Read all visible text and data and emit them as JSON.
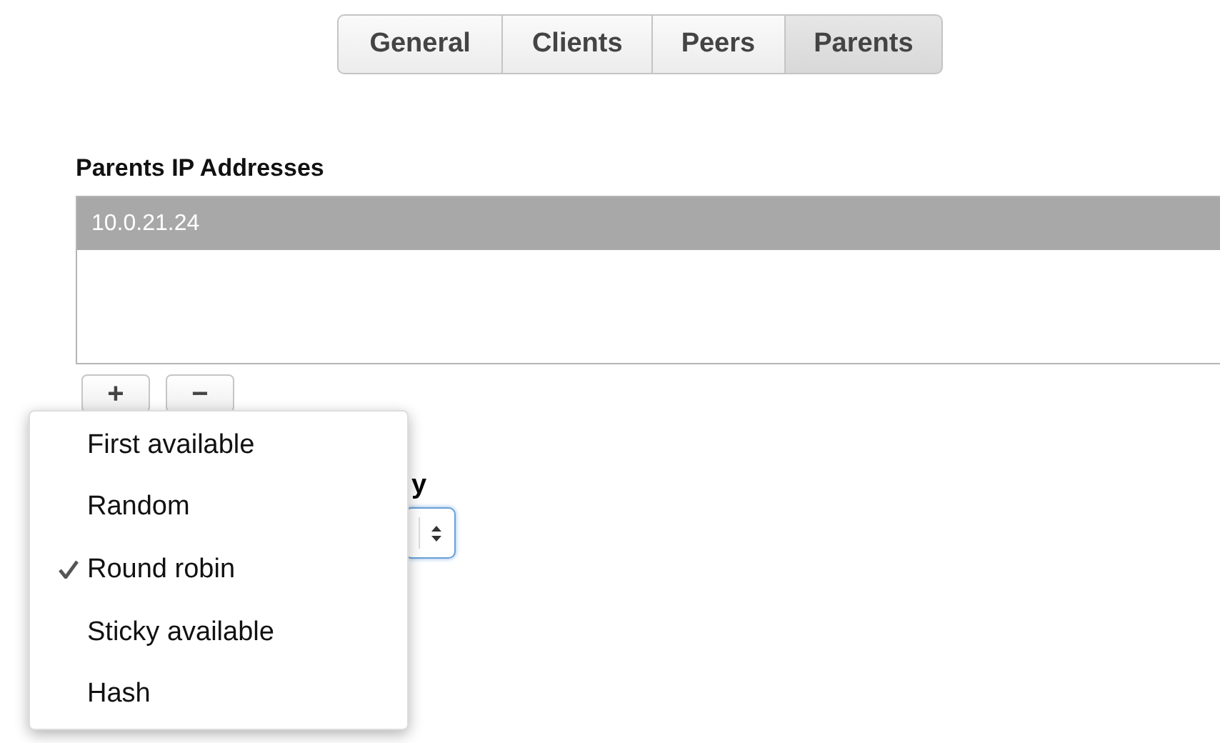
{
  "tabs": [
    {
      "label": "General",
      "selected": false
    },
    {
      "label": "Clients",
      "selected": false
    },
    {
      "label": "Peers",
      "selected": false
    },
    {
      "label": "Parents",
      "selected": true
    }
  ],
  "addresses": {
    "heading": "Parents IP Addresses",
    "items": [
      {
        "label": "10.0.21.24",
        "selected": true
      }
    ],
    "buttons": [
      "+",
      "−"
    ]
  },
  "policy": {
    "label": "y"
  },
  "menu": {
    "items": [
      {
        "label": "First available",
        "checked": false
      },
      {
        "label": "Random",
        "checked": false
      },
      {
        "label": "Round robin",
        "checked": true
      },
      {
        "label": "Sticky available",
        "checked": false
      },
      {
        "label": "Hash",
        "checked": false
      }
    ]
  }
}
